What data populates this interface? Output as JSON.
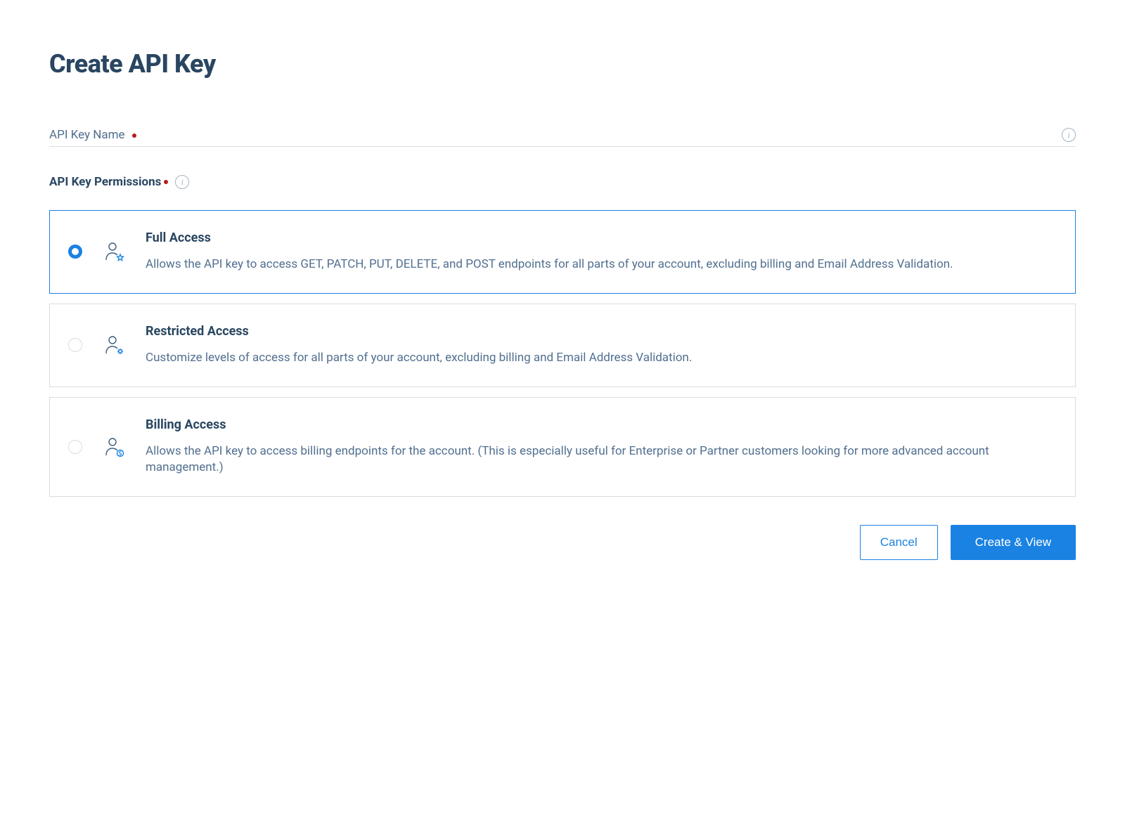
{
  "page": {
    "title": "Create API Key"
  },
  "fields": {
    "name_label": "API Key Name",
    "permissions_label": "API Key Permissions"
  },
  "options": {
    "full": {
      "title": "Full Access",
      "description": "Allows the API key to access GET, PATCH, PUT, DELETE, and POST endpoints for all parts of your account, excluding billing and Email Address Validation.",
      "selected": true
    },
    "restricted": {
      "title": "Restricted Access",
      "description": "Customize levels of access for all parts of your account, excluding billing and Email Address Validation.",
      "selected": false
    },
    "billing": {
      "title": "Billing Access",
      "description": "Allows the API key to access billing endpoints for the account. (This is especially useful for Enterprise or Partner customers looking for more advanced account management.)",
      "selected": false
    }
  },
  "actions": {
    "cancel": "Cancel",
    "submit": "Create & View"
  }
}
